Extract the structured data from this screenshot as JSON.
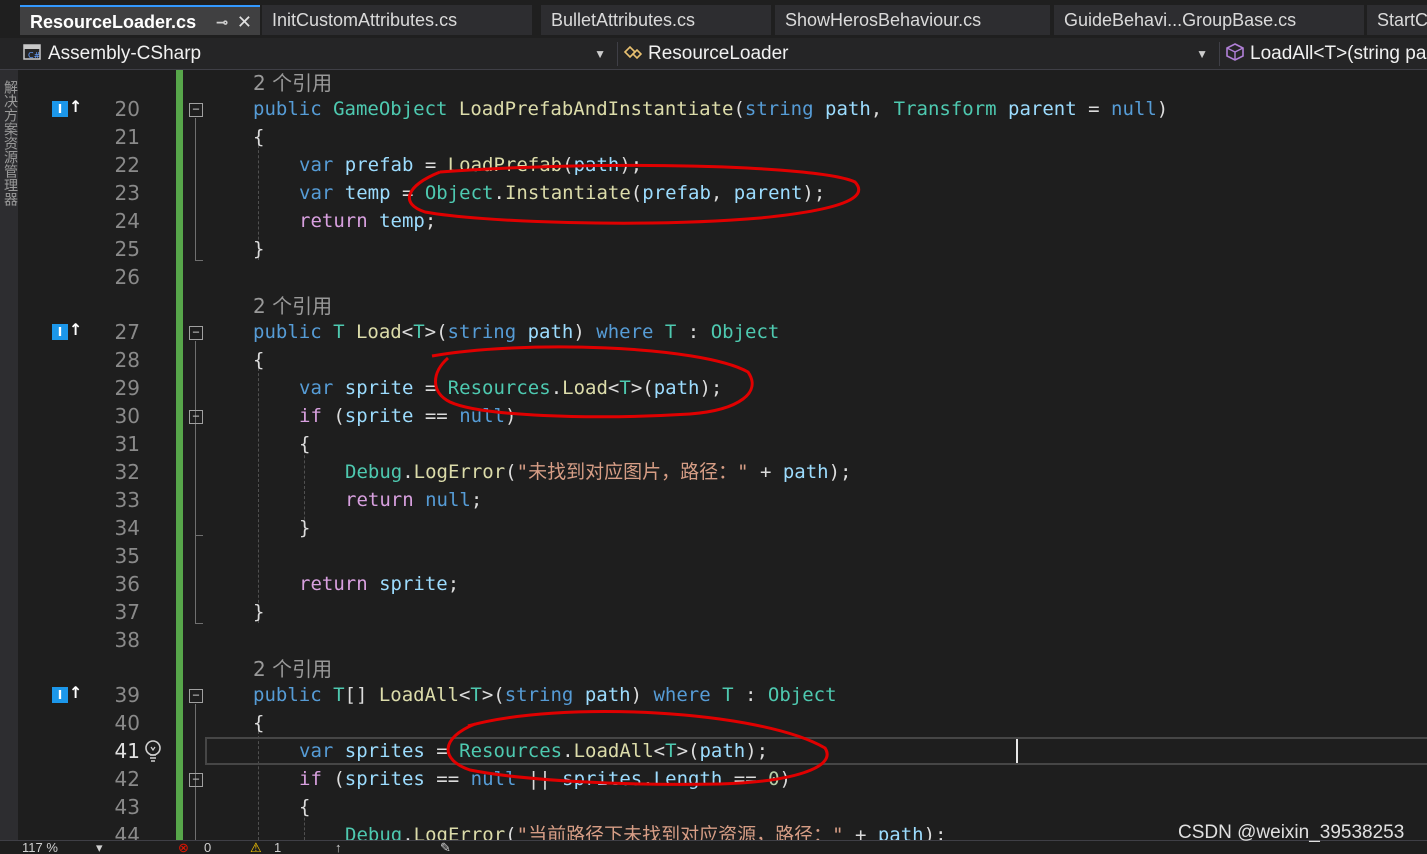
{
  "tabs": [
    {
      "label": "ResourceLoader.cs",
      "active": true
    },
    {
      "label": "InitCustomAttributes.cs"
    },
    {
      "label": "BulletAttributes.cs"
    },
    {
      "label": "ShowHerosBehaviour.cs"
    },
    {
      "label": "GuideBehavi...GroupBase.cs"
    },
    {
      "label": "StartC"
    }
  ],
  "tab_icons": {
    "pin": "pin-icon",
    "close": "close-icon"
  },
  "nav": {
    "project": "Assembly-CSharp",
    "class": "ResourceLoader",
    "member": "LoadAll<T>(string pa"
  },
  "left_strip_label": "解决方案资源管理器",
  "code_lens": [
    "2 个引用",
    "2 个引用",
    "2 个引用",
    "2 个引用"
  ],
  "line_numbers": [
    "20",
    "21",
    "22",
    "23",
    "24",
    "25",
    "26",
    "27",
    "28",
    "29",
    "30",
    "31",
    "32",
    "33",
    "34",
    "35",
    "36",
    "37",
    "38",
    "39",
    "40",
    "41",
    "42",
    "43",
    "44"
  ],
  "code_lines": {
    "l20": [
      "public ",
      "GameObject ",
      "LoadPrefabAndInstantiate",
      "(",
      "string ",
      "path",
      ", ",
      "Transform ",
      "parent",
      " = ",
      "null",
      ")"
    ],
    "l21": [
      "{"
    ],
    "l22": [
      "var ",
      "prefab",
      " = ",
      "LoadPrefab",
      "(",
      "path",
      ");"
    ],
    "l23": [
      "var ",
      "temp",
      " = ",
      "Object",
      ".",
      "Instantiate",
      "(",
      "prefab",
      ", ",
      "parent",
      ");"
    ],
    "l24": [
      "return ",
      "temp",
      ";"
    ],
    "l25": [
      "}"
    ],
    "l27": [
      "public ",
      "T ",
      "Load",
      "<",
      "T",
      ">(",
      "string ",
      "path",
      ") ",
      "where ",
      "T",
      " : ",
      "Object"
    ],
    "l28": [
      "{"
    ],
    "l29": [
      "var ",
      "sprite",
      " = ",
      "Resources",
      ".",
      "Load",
      "<",
      "T",
      ">(",
      "path",
      ");"
    ],
    "l30": [
      "if ",
      "(",
      "sprite",
      " == ",
      "null",
      ")"
    ],
    "l31": [
      "{"
    ],
    "l32": [
      "Debug",
      ".",
      "LogError",
      "(",
      "\"未找到对应图片，路径：\"",
      " + ",
      "path",
      ");"
    ],
    "l33": [
      "return ",
      "null",
      ";"
    ],
    "l34": [
      "}"
    ],
    "l36": [
      "return ",
      "sprite",
      ";"
    ],
    "l37": [
      "}"
    ],
    "l39": [
      "public ",
      "T",
      "[] ",
      "LoadAll",
      "<",
      "T",
      ">(",
      "string ",
      "path",
      ") ",
      "where ",
      "T",
      " : ",
      "Object"
    ],
    "l40": [
      "{"
    ],
    "l41": [
      "var ",
      "sprites",
      " = ",
      "Resources",
      ".",
      "LoadAll",
      "<",
      "T",
      ">(",
      "path",
      ");"
    ],
    "l42": [
      "if ",
      "(",
      "sprites",
      " == ",
      "null",
      " || ",
      "sprites",
      ".",
      "Length",
      " == ",
      "0",
      ")"
    ],
    "l43": [
      "{"
    ],
    "l44": [
      "Debug",
      ".",
      "LogError",
      "(",
      "\"当前路径下未找到对应资源，路径：\"",
      " + ",
      "path",
      ");"
    ]
  },
  "status": {
    "zoom": "117 %",
    "errors": "0",
    "warnings": "1"
  },
  "watermark": "CSDN @weixin_39538253",
  "colors": {
    "keyword": "#569cd6",
    "control": "#d8a0df",
    "type": "#4ec9b0",
    "method": "#dcdcaa",
    "identifier": "#9cdcfe",
    "string": "#d69d85",
    "annotation": "#e00000",
    "change_bar": "#57a64a"
  }
}
